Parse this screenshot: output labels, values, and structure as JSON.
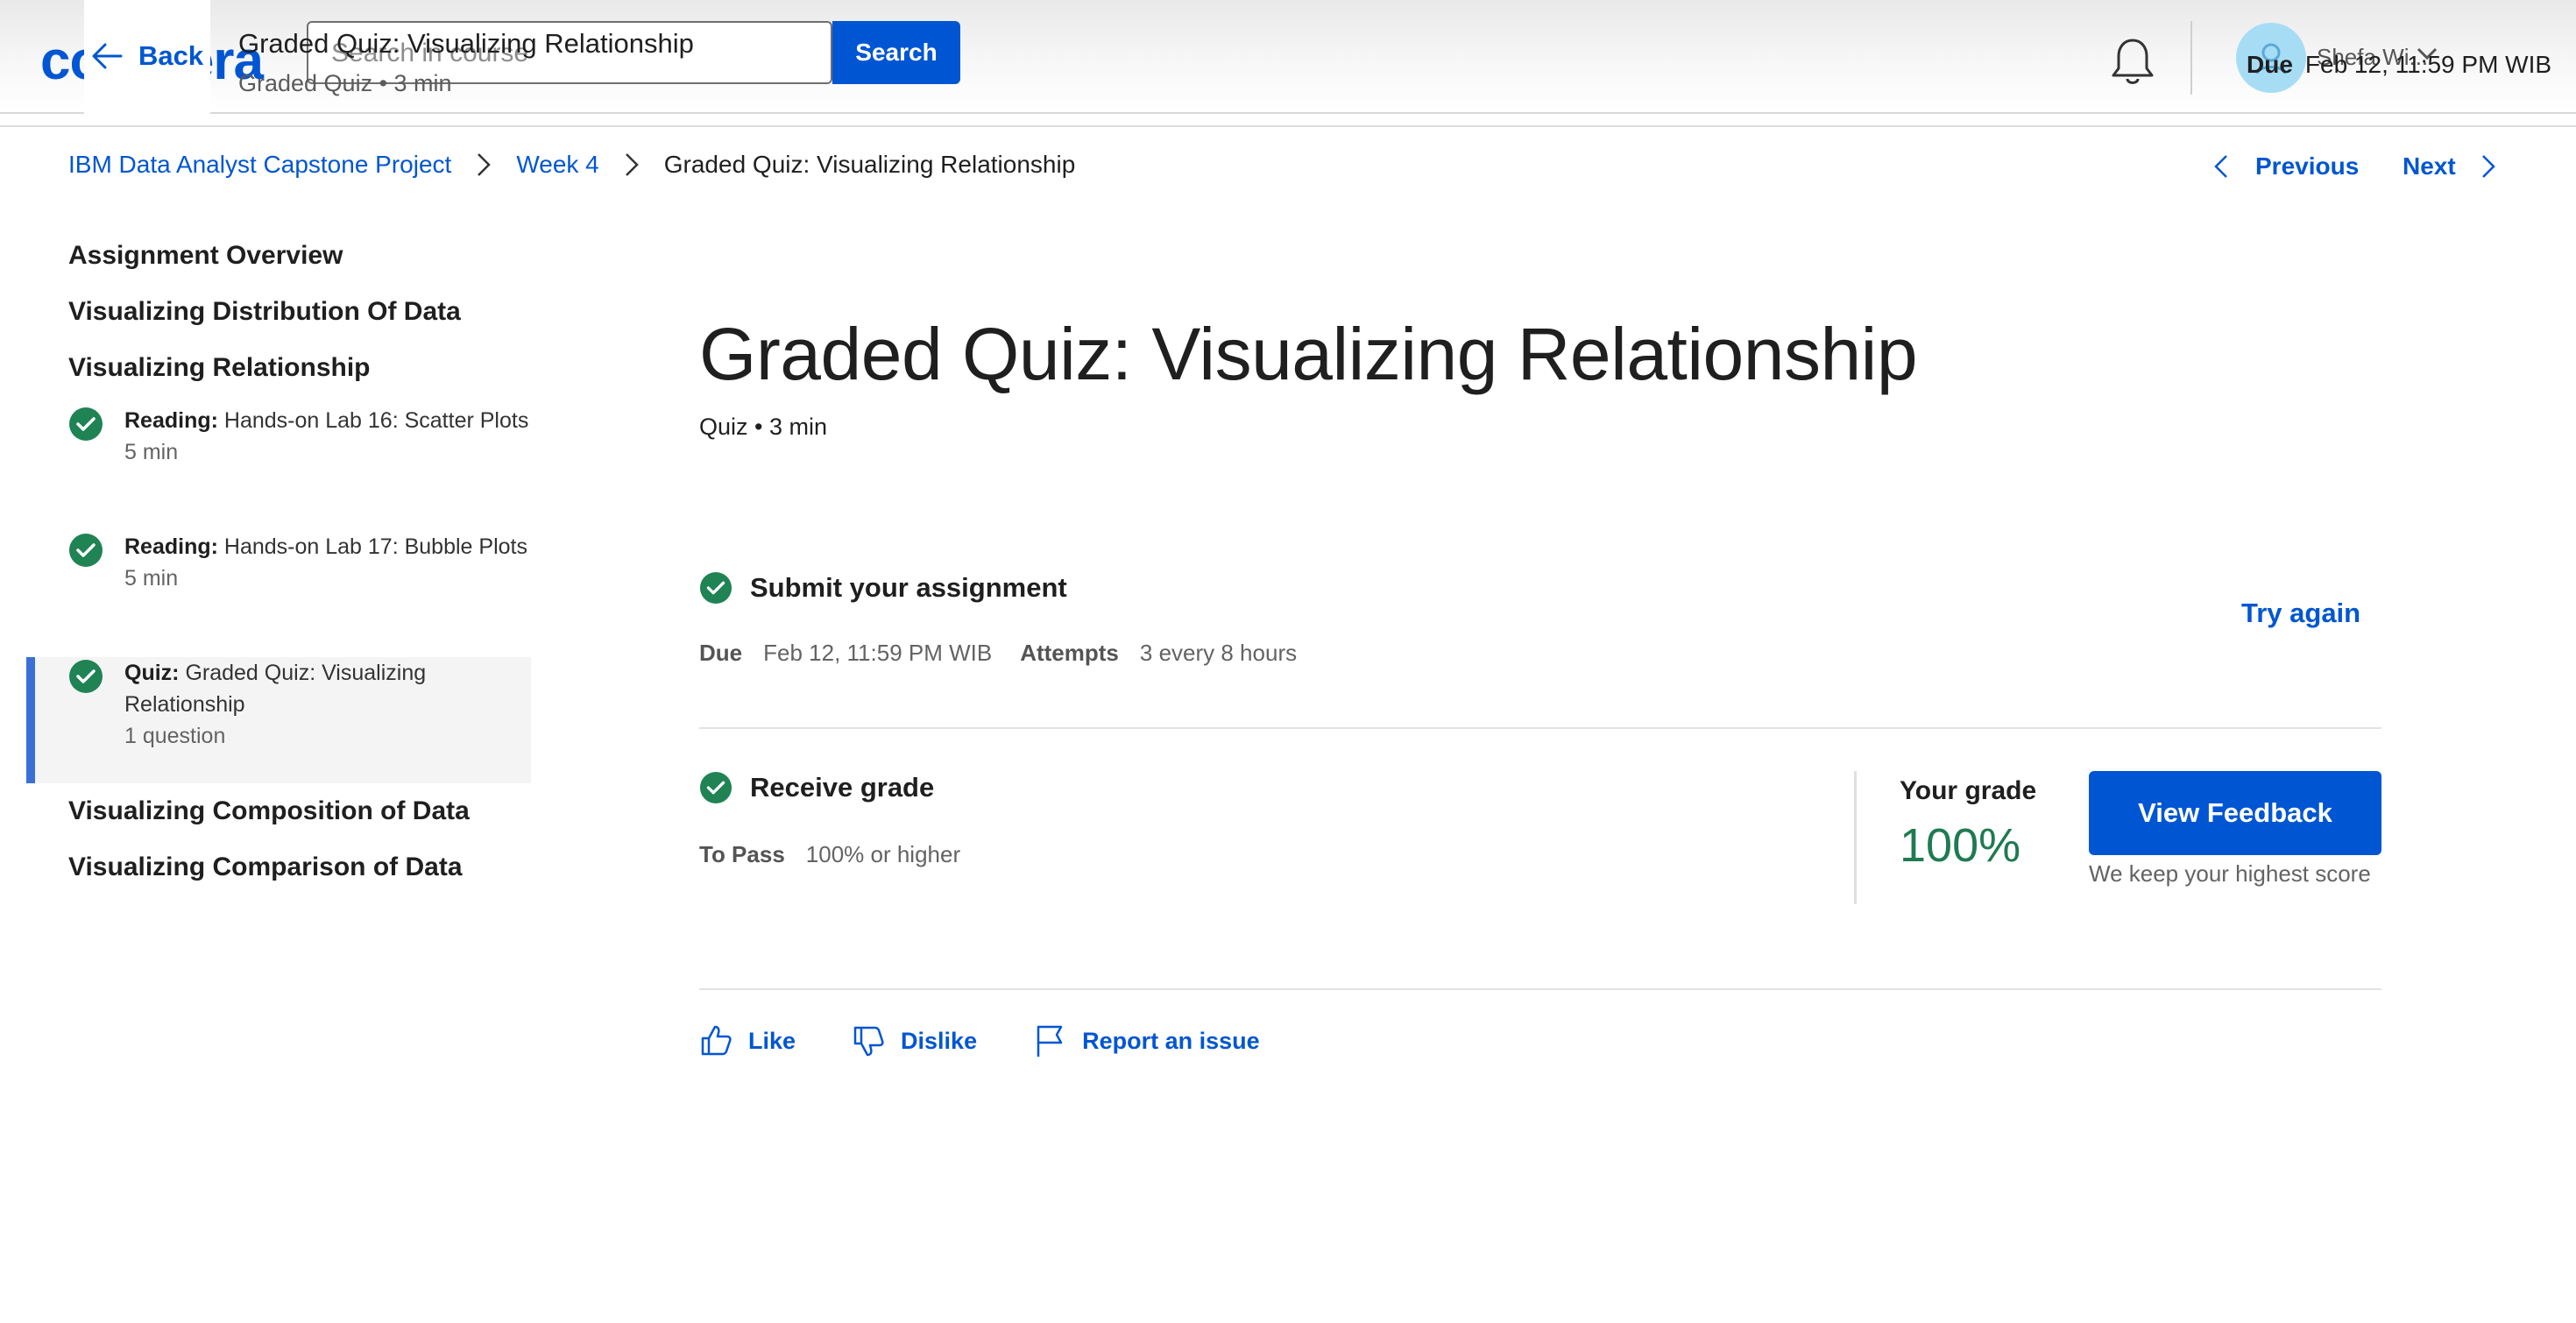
{
  "header": {
    "logo": "coursera",
    "back_label": "Back",
    "search_placeholder": "Search in course",
    "search_button": "Search",
    "item_title": "Graded Quiz: Visualizing Relationship",
    "item_meta": "Graded Quiz • 3 min",
    "user_name": "Shefa Wi...",
    "due_label": "Due",
    "due_value": "Feb 12, 11:59 PM WIB"
  },
  "breadcrumb": {
    "items": [
      "IBM Data Analyst Capstone Project",
      "Week 4",
      "Graded Quiz: Visualizing Relationship"
    ]
  },
  "pager": {
    "previous": "Previous",
    "next": "Next"
  },
  "sidebar": {
    "sections": [
      "Assignment Overview",
      "Visualizing Distribution Of Data",
      "Visualizing Relationship",
      "Visualizing Composition of Data",
      "Visualizing Comparison of Data"
    ],
    "lessons": [
      {
        "type": "Reading:",
        "title": "Hands-on Lab 16: Scatter Plots",
        "meta": "5 min"
      },
      {
        "type": "Reading:",
        "title": "Hands-on Lab 17: Bubble Plots",
        "meta": "5 min"
      },
      {
        "type": "Quiz:",
        "title": "Graded Quiz: Visualizing Relationship",
        "meta": "1 question"
      }
    ]
  },
  "main": {
    "title": "Graded Quiz: Visualizing Relationship",
    "meta": "Quiz • 3 min",
    "submit": {
      "heading": "Submit your assignment",
      "due_label": "Due",
      "due_value": "Feb 12, 11:59 PM WIB",
      "attempts_label": "Attempts",
      "attempts_value": "3 every 8 hours",
      "try_again": "Try again"
    },
    "receive": {
      "heading": "Receive grade",
      "to_pass_label": "To Pass",
      "to_pass_value": "100% or higher",
      "your_grade_label": "Your grade",
      "your_grade_value": "100%",
      "feedback_button": "View Feedback",
      "keep_note": "We keep your highest score"
    },
    "reactions": {
      "like": "Like",
      "dislike": "Dislike",
      "report": "Report an issue"
    }
  },
  "colors": {
    "accent": "#0056d2",
    "success": "#1f8354",
    "grade": "#1f7a52",
    "active_bar": "#3a6fd8"
  }
}
